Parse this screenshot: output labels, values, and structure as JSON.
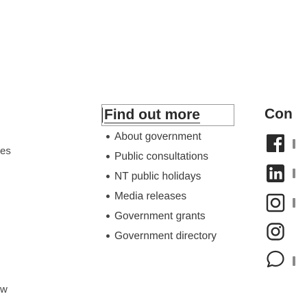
{
  "left_cut": {
    "line1": "es",
    "line2": "w"
  },
  "find_out_more": {
    "heading": "Find out more",
    "items": [
      {
        "label": "About government"
      },
      {
        "label": "Public consultations"
      },
      {
        "label": "NT public holidays"
      },
      {
        "label": "Media releases"
      },
      {
        "label": "Government grants"
      },
      {
        "label": "Government directory"
      }
    ]
  },
  "contact": {
    "heading": "Con",
    "social": [
      {
        "icon": "facebook-icon"
      },
      {
        "icon": "linkedin-icon"
      },
      {
        "icon": "flickr-icon"
      },
      {
        "icon": "instagram-icon"
      },
      {
        "icon": "twitter-icon"
      }
    ]
  },
  "colors": {
    "text": "#333333",
    "icon": "#2b2b2b",
    "border": "#9a9a9a"
  }
}
